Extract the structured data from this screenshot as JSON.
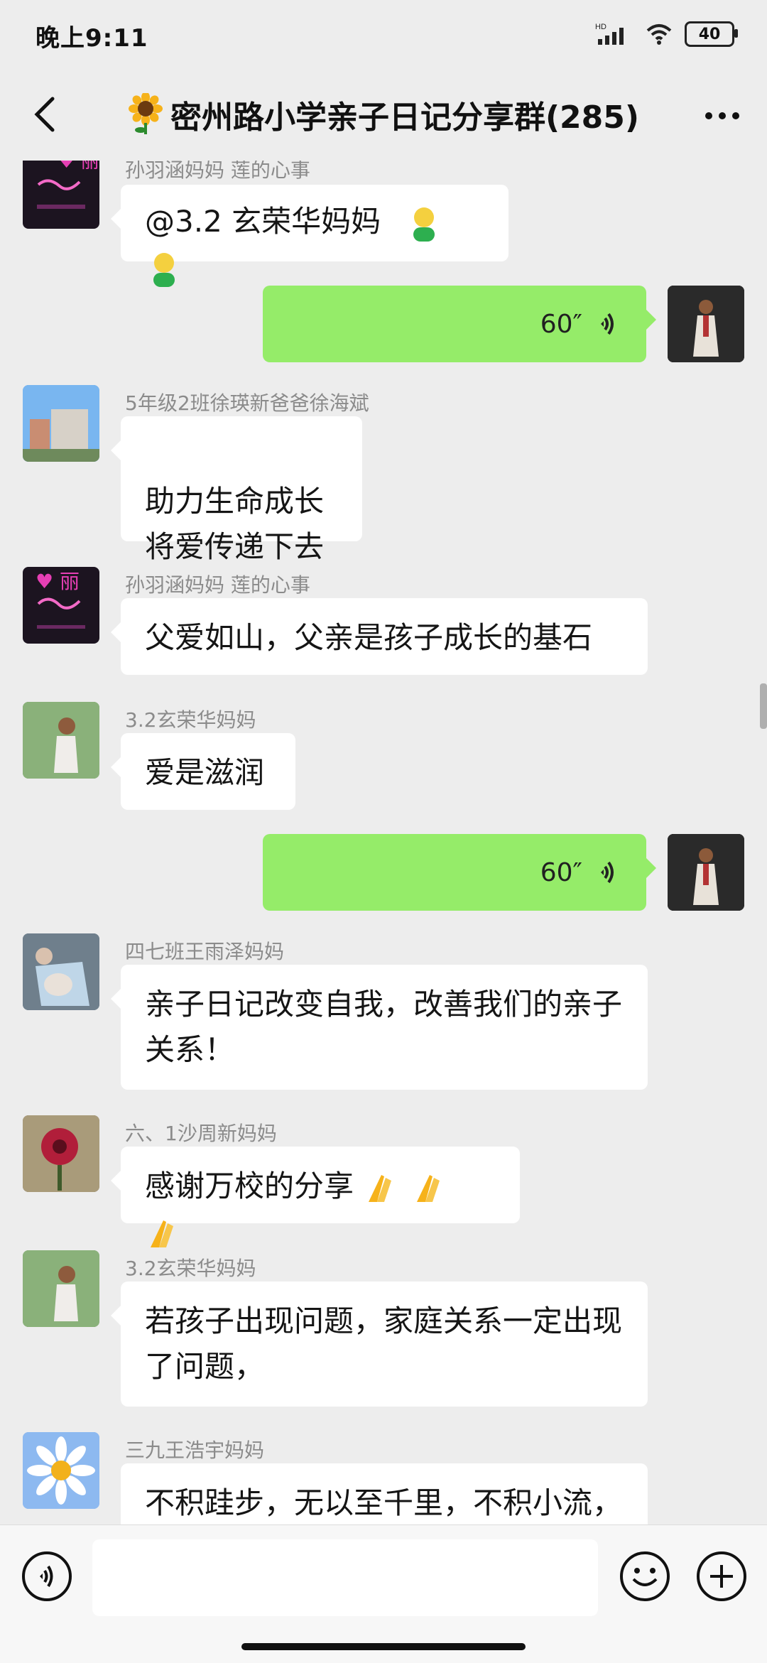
{
  "status": {
    "time": "晚上9:11",
    "hd": "HD",
    "battery": "40"
  },
  "header": {
    "title": "密州路小学亲子日记分享群(285)",
    "back_icon": "back-chevron-icon",
    "more_icon": "more-dots-icon",
    "group_icon": "sunflower-icon"
  },
  "messages": [
    {
      "sender": "孙羽涵妈妈  莲的心事",
      "text": "@3.2 玄荣华妈妈",
      "emoji": [
        "person-icon",
        "person-icon"
      ]
    },
    {
      "duration": "60″"
    },
    {
      "sender": "5年级2班徐瑛新爸爸徐海斌",
      "text": "助力生命成长\n将爱传递下去"
    },
    {
      "sender": "孙羽涵妈妈  莲的心事",
      "text": "父爱如山，父亲是孩子成长的基石"
    },
    {
      "sender": "3.2玄荣华妈妈",
      "text": "爱是滋润"
    },
    {
      "duration": "60″"
    },
    {
      "sender": "四七班王雨泽妈妈",
      "text": "亲子日记改变自我，改善我们的亲子关系！"
    },
    {
      "sender": "六、1沙周新妈妈",
      "text": "感谢万校的分享",
      "emoji": [
        "pray-icon",
        "pray-icon",
        "pray-icon"
      ]
    },
    {
      "sender": "3.2玄荣华妈妈",
      "text": "若孩子出现问题，家庭关系一定出现了问题，"
    },
    {
      "sender": "三九王浩宇妈妈",
      "text": "不积跬步，无以至千里，不积小流，"
    }
  ],
  "input": {
    "placeholder": "",
    "voice_icon": "voice-mode-icon",
    "emoji_icon": "emoji-icon",
    "plus_icon": "plus-icon"
  },
  "colors": {
    "background": "#EDEDED",
    "bubble_right": "#95EC69",
    "bubble_left": "#FFFFFF"
  }
}
